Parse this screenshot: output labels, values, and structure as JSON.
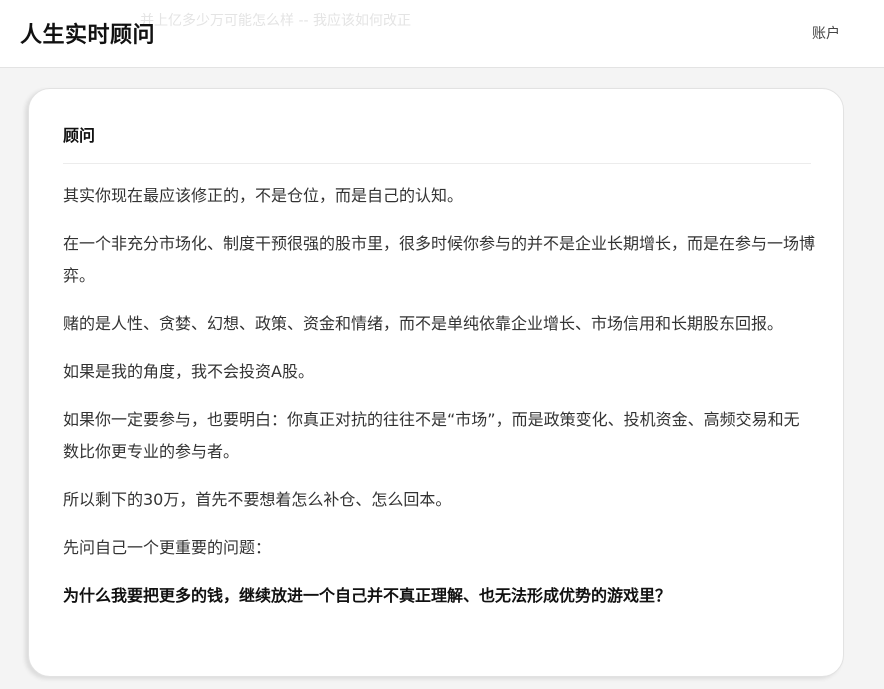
{
  "header": {
    "title": "人生实时顾问",
    "account_label": "账户",
    "ghost_text": "并上亿多少万可能怎么样 -- 我应该如何改正"
  },
  "card": {
    "title": "顾问",
    "paragraphs": [
      "其实你现在最应该修正的，不是仓位，而是自己的认知。",
      "在一个非充分市场化、制度干预很强的股市里，很多时候你参与的并不是企业长期增长，而是在参与一场博弈。",
      "赌的是人性、贪婪、幻想、政策、资金和情绪，而不是单纯依靠企业增长、市场信用和长期股东回报。",
      "如果是我的角度，我不会投资A股。",
      "如果你一定要参与，也要明白：你真正对抗的往往不是“市场”，而是政策变化、投机资金、高频交易和无数比你更专业的参与者。",
      "所以剩下的30万，首先不要想着怎么补仓、怎么回本。",
      "先问自己一个更重要的问题："
    ],
    "emphasis": "为什么我要把更多的钱，继续放进一个自己并不真正理解、也无法形成优势的游戏里？"
  }
}
